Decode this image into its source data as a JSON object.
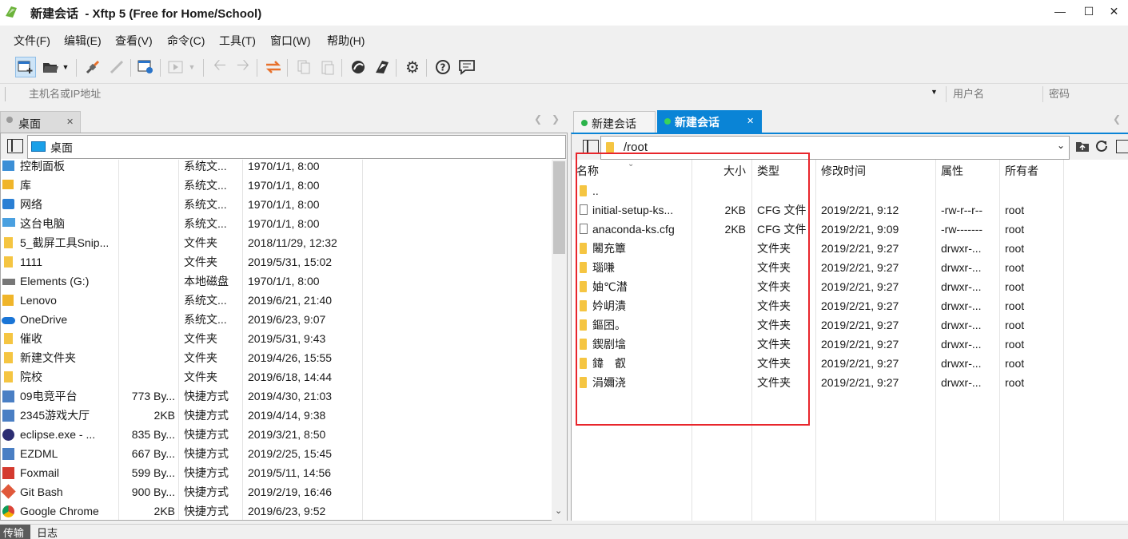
{
  "title": {
    "session": "新建会话",
    "app": "  - Xftp 5 (Free for Home/School)"
  },
  "menu": [
    "文件(F)",
    "编辑(E)",
    "查看(V)",
    "命令(C)",
    "工具(T)",
    "窗口(W)",
    "帮助(H)"
  ],
  "address": {
    "host_placeholder": "主机名或IP地址",
    "user_placeholder": "用户名",
    "password_placeholder": "密码"
  },
  "left": {
    "tab_label": "桌面",
    "path": "桌面",
    "rows": [
      {
        "name": "控制面板",
        "size": "",
        "type": "系统文...",
        "date": "1970/1/1, 8:00",
        "icon": "control-panel-icon"
      },
      {
        "name": "库",
        "size": "",
        "type": "系统文...",
        "date": "1970/1/1, 8:00",
        "icon": "library-icon"
      },
      {
        "name": "网络",
        "size": "",
        "type": "系统文...",
        "date": "1970/1/1, 8:00",
        "icon": "network-icon"
      },
      {
        "name": "这台电脑",
        "size": "",
        "type": "系统文...",
        "date": "1970/1/1, 8:00",
        "icon": "computer-icon"
      },
      {
        "name": "5_截屏工具Snip...",
        "size": "",
        "type": "文件夹",
        "date": "2018/11/29, 12:32",
        "icon": "folder-icon"
      },
      {
        "name": "1111",
        "size": "",
        "type": "文件夹",
        "date": "2019/5/31, 15:02",
        "icon": "folder-icon"
      },
      {
        "name": "Elements (G:)",
        "size": "",
        "type": "本地磁盘",
        "date": "1970/1/1, 8:00",
        "icon": "drive-icon"
      },
      {
        "name": "Lenovo",
        "size": "",
        "type": "系统文...",
        "date": "2019/6/21, 21:40",
        "icon": "user-folder-icon"
      },
      {
        "name": "OneDrive",
        "size": "",
        "type": "系统文...",
        "date": "2019/6/23, 9:07",
        "icon": "cloud-icon"
      },
      {
        "name": "催收",
        "size": "",
        "type": "文件夹",
        "date": "2019/5/31, 9:43",
        "icon": "folder-icon"
      },
      {
        "name": "新建文件夹",
        "size": "",
        "type": "文件夹",
        "date": "2019/4/26, 15:55",
        "icon": "folder-icon"
      },
      {
        "name": "院校",
        "size": "",
        "type": "文件夹",
        "date": "2019/6/18, 14:44",
        "icon": "folder-icon"
      },
      {
        "name": "09电竞平台",
        "size": "773 By...",
        "type": "快捷方式",
        "date": "2019/4/30, 21:03",
        "icon": "shortcut-icon"
      },
      {
        "name": "2345游戏大厅",
        "size": "2KB",
        "type": "快捷方式",
        "date": "2019/4/14, 9:38",
        "icon": "shortcut-icon"
      },
      {
        "name": "eclipse.exe - ...",
        "size": "835 By...",
        "type": "快捷方式",
        "date": "2019/3/21, 8:50",
        "icon": "eclipse-icon"
      },
      {
        "name": "EZDML",
        "size": "667 By...",
        "type": "快捷方式",
        "date": "2019/2/25, 15:45",
        "icon": "shortcut-icon"
      },
      {
        "name": "Foxmail",
        "size": "599 By...",
        "type": "快捷方式",
        "date": "2019/5/11, 14:56",
        "icon": "foxmail-icon"
      },
      {
        "name": "Git Bash",
        "size": "900 By...",
        "type": "快捷方式",
        "date": "2019/2/19, 16:46",
        "icon": "git-icon"
      },
      {
        "name": "Google Chrome",
        "size": "2KB",
        "type": "快捷方式",
        "date": "2019/6/23, 9:52",
        "icon": "chrome-icon"
      }
    ]
  },
  "right": {
    "tabs": [
      {
        "label": "新建会话",
        "active": false
      },
      {
        "label": "新建会话",
        "active": true
      }
    ],
    "path": "/root",
    "headers": {
      "name": "名称",
      "size": "大小",
      "type": "类型",
      "date": "修改时间",
      "attr": "属性",
      "owner": "所有者"
    },
    "rows": [
      {
        "name": "..",
        "size": "",
        "type": "",
        "date": "",
        "attr": "",
        "owner": "",
        "kind": "folder"
      },
      {
        "name": "initial-setup-ks...",
        "size": "2KB",
        "type": "CFG 文件",
        "date": "2019/2/21, 9:12",
        "attr": "-rw-r--r--",
        "owner": "root",
        "kind": "file"
      },
      {
        "name": "anaconda-ks.cfg",
        "size": "2KB",
        "type": "CFG 文件",
        "date": "2019/2/21, 9:09",
        "attr": "-rw-------",
        "owner": "root",
        "kind": "file"
      },
      {
        "name": "闂充簟",
        "size": "",
        "type": "文件夹",
        "date": "2019/2/21, 9:27",
        "attr": "drwxr-...",
        "owner": "root",
        "kind": "folder"
      },
      {
        "name": "瑙嗛",
        "size": "",
        "type": "文件夹",
        "date": "2019/2/21, 9:27",
        "attr": "drwxr-...",
        "owner": "root",
        "kind": "folder"
      },
      {
        "name": "妯℃澘",
        "size": "",
        "type": "文件夹",
        "date": "2019/2/21, 9:27",
        "attr": "drwxr-...",
        "owner": "root",
        "kind": "folder"
      },
      {
        "name": "妗岄潰",
        "size": "",
        "type": "文件夹",
        "date": "2019/2/21, 9:27",
        "attr": "drwxr-...",
        "owner": "root",
        "kind": "folder"
      },
      {
        "name": "鏂囨。",
        "size": "",
        "type": "文件夹",
        "date": "2019/2/21, 9:27",
        "attr": "drwxr-...",
        "owner": "root",
        "kind": "folder"
      },
      {
        "name": "鍥剧墖",
        "size": "",
        "type": "文件夹",
        "date": "2019/2/21, 9:27",
        "attr": "drwxr-...",
        "owner": "root",
        "kind": "folder"
      },
      {
        "name": "鍏　叡",
        "size": "",
        "type": "文件夹",
        "date": "2019/2/21, 9:27",
        "attr": "drwxr-...",
        "owner": "root",
        "kind": "folder"
      },
      {
        "name": "涓嬭浇",
        "size": "",
        "type": "文件夹",
        "date": "2019/2/21, 9:27",
        "attr": "drwxr-...",
        "owner": "root",
        "kind": "folder"
      }
    ]
  },
  "bottom_tabs": [
    "传输",
    "日志"
  ],
  "colors": {
    "accent": "#0a84d6",
    "highlight": "#e8262c",
    "session_dot": "#2bb34a"
  }
}
